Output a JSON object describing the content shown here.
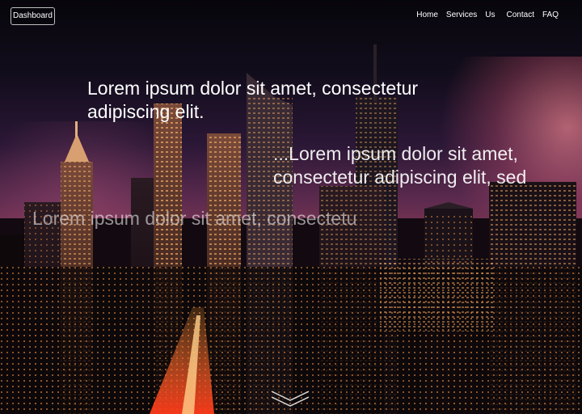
{
  "topbar": {
    "logo_label": "Dashboard",
    "nav": [
      "Home",
      "Services",
      "Us",
      "Contact",
      "FAQ"
    ]
  },
  "hero": {
    "line1a": "Lorem ipsum dolor sit amet, consectetur",
    "line1b": "adipiscing elit.",
    "line2a": "...Lorem ipsum dolor sit amet,",
    "line2b": "consectetur adipiscing elit, sed",
    "line3": "Lorem ipsum dolor sit amet, consectetu"
  },
  "icons": {
    "scroll": "chevron-down-icon"
  },
  "colors": {
    "text": "#ffffff",
    "sky_accent": "#ff8c96"
  }
}
